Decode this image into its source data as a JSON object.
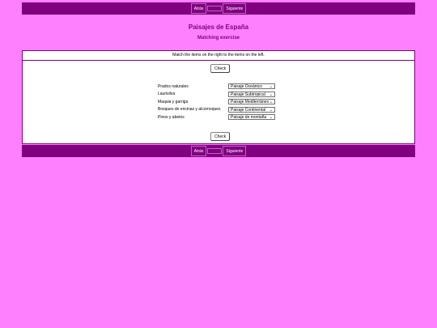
{
  "nav": {
    "back_label": "Atrás",
    "next_label": "Siguiente"
  },
  "header": {
    "title": "Paisajes de España",
    "subtitle": "Matching exercise"
  },
  "exercise": {
    "instructions": "Match the items on the right to the items on the left.",
    "check_label": "Check",
    "rows": [
      {
        "label": "Prados naturales",
        "selected": "Paisaje Oceánico"
      },
      {
        "label": "Laurisilva",
        "selected": "Paisaje Subtropical"
      },
      {
        "label": "Maquia y garriga",
        "selected": "Paisaje Mediterráneo"
      },
      {
        "label": "Bosques de encinas y alcornoques",
        "selected": "Paisaje Continental"
      },
      {
        "label": "Pinos y abetos",
        "selected": "Paisaje de montaña"
      }
    ]
  }
}
